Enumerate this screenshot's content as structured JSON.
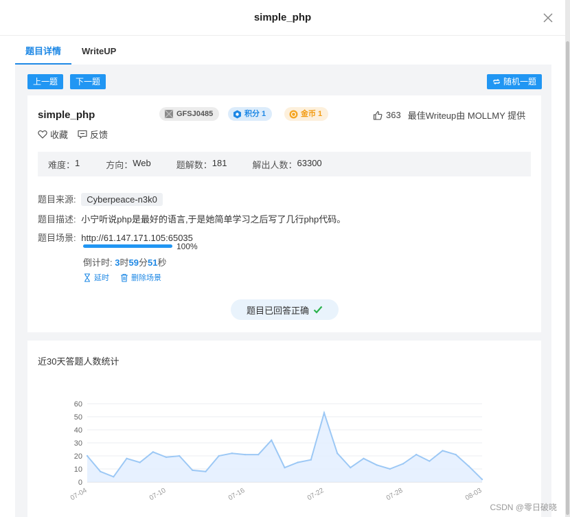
{
  "modal": {
    "title": "simple_php"
  },
  "tabs": [
    {
      "label": "题目详情",
      "active": true
    },
    {
      "label": "WriteUP",
      "active": false
    }
  ],
  "nav": {
    "prev": "上一题",
    "next": "下一题",
    "random": "随机一题"
  },
  "challenge": {
    "name": "simple_php",
    "id": "GFSJ0485",
    "score": "积分 1",
    "coins": "金币 1",
    "likes": "363",
    "best_writeup": "最佳Writeup由 MOLLMY 提供",
    "favorite": "收藏",
    "feedback": "反馈",
    "difficulty_label": "难度：",
    "difficulty": "1",
    "direction_label": "方向：",
    "direction": "Web",
    "writeups_label": "题解数：",
    "writeups": "181",
    "solvers_label": "解出人数：",
    "solvers": "63300",
    "source_label": "题目来源:",
    "source": "Cyberpeace-n3k0",
    "desc_label": "题目描述:",
    "description": "小宁听说php是最好的语言,于是她简单学习之后写了几行php代码。",
    "scene_label": "题目场景:",
    "scene_url": "http://61.147.171.105:65035",
    "progress_text": "100%",
    "progress": 1.0,
    "countdown_label": "倒计时: ",
    "cd_h": "3",
    "cd_h_unit": "时",
    "cd_m": "59",
    "cd_m_unit": "分",
    "cd_s": "51",
    "cd_s_unit": "秒",
    "extend": "延时",
    "delete_scene": "删除场景",
    "solved_text": "题目已回答正确"
  },
  "stats": {
    "title": "近30天答题人数统计"
  },
  "chart_data": {
    "type": "area",
    "x": [
      "07-04",
      "07-05",
      "07-06",
      "07-07",
      "07-08",
      "07-09",
      "07-10",
      "07-11",
      "07-12",
      "07-13",
      "07-14",
      "07-15",
      "07-16",
      "07-17",
      "07-18",
      "07-19",
      "07-20",
      "07-21",
      "07-22",
      "07-23",
      "07-24",
      "07-25",
      "07-26",
      "07-27",
      "07-28",
      "07-29",
      "07-30",
      "07-31",
      "08-01",
      "08-02",
      "08-03"
    ],
    "xticks": [
      "07-04",
      "07-10",
      "07-16",
      "07-22",
      "07-28",
      "08-03"
    ],
    "yticks": [
      0,
      10,
      20,
      30,
      40,
      50,
      60
    ],
    "ylim": [
      0,
      60
    ],
    "values": [
      20,
      8,
      4,
      18,
      15,
      23,
      19,
      20,
      9,
      8,
      20,
      22,
      21,
      21,
      32,
      11,
      15,
      17,
      53,
      22,
      11,
      18,
      13,
      10,
      14,
      21,
      16,
      24,
      21,
      12,
      2
    ],
    "line_color": "#9cc8f5",
    "fill_color": "#e3efff",
    "grid": true
  },
  "colors": {
    "accent": "#2196f3",
    "success": "#2bb24c",
    "coin": "#f29b12"
  },
  "watermark": "CSDN @零日破晓"
}
